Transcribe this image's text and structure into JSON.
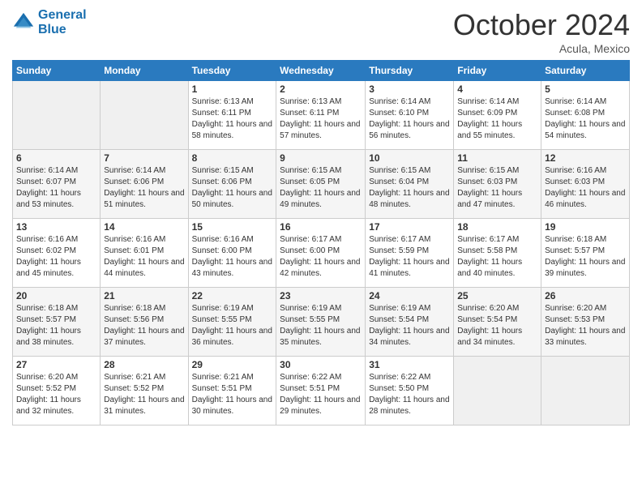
{
  "logo": {
    "line1": "General",
    "line2": "Blue"
  },
  "header": {
    "month": "October 2024",
    "location": "Acula, Mexico"
  },
  "weekdays": [
    "Sunday",
    "Monday",
    "Tuesday",
    "Wednesday",
    "Thursday",
    "Friday",
    "Saturday"
  ],
  "weeks": [
    [
      {
        "day": "",
        "sunrise": "",
        "sunset": "",
        "daylight": "",
        "empty": true
      },
      {
        "day": "",
        "sunrise": "",
        "sunset": "",
        "daylight": "",
        "empty": true
      },
      {
        "day": "1",
        "sunrise": "Sunrise: 6:13 AM",
        "sunset": "Sunset: 6:11 PM",
        "daylight": "Daylight: 11 hours and 58 minutes."
      },
      {
        "day": "2",
        "sunrise": "Sunrise: 6:13 AM",
        "sunset": "Sunset: 6:11 PM",
        "daylight": "Daylight: 11 hours and 57 minutes."
      },
      {
        "day": "3",
        "sunrise": "Sunrise: 6:14 AM",
        "sunset": "Sunset: 6:10 PM",
        "daylight": "Daylight: 11 hours and 56 minutes."
      },
      {
        "day": "4",
        "sunrise": "Sunrise: 6:14 AM",
        "sunset": "Sunset: 6:09 PM",
        "daylight": "Daylight: 11 hours and 55 minutes."
      },
      {
        "day": "5",
        "sunrise": "Sunrise: 6:14 AM",
        "sunset": "Sunset: 6:08 PM",
        "daylight": "Daylight: 11 hours and 54 minutes."
      }
    ],
    [
      {
        "day": "6",
        "sunrise": "Sunrise: 6:14 AM",
        "sunset": "Sunset: 6:07 PM",
        "daylight": "Daylight: 11 hours and 53 minutes."
      },
      {
        "day": "7",
        "sunrise": "Sunrise: 6:14 AM",
        "sunset": "Sunset: 6:06 PM",
        "daylight": "Daylight: 11 hours and 51 minutes."
      },
      {
        "day": "8",
        "sunrise": "Sunrise: 6:15 AM",
        "sunset": "Sunset: 6:06 PM",
        "daylight": "Daylight: 11 hours and 50 minutes."
      },
      {
        "day": "9",
        "sunrise": "Sunrise: 6:15 AM",
        "sunset": "Sunset: 6:05 PM",
        "daylight": "Daylight: 11 hours and 49 minutes."
      },
      {
        "day": "10",
        "sunrise": "Sunrise: 6:15 AM",
        "sunset": "Sunset: 6:04 PM",
        "daylight": "Daylight: 11 hours and 48 minutes."
      },
      {
        "day": "11",
        "sunrise": "Sunrise: 6:15 AM",
        "sunset": "Sunset: 6:03 PM",
        "daylight": "Daylight: 11 hours and 47 minutes."
      },
      {
        "day": "12",
        "sunrise": "Sunrise: 6:16 AM",
        "sunset": "Sunset: 6:03 PM",
        "daylight": "Daylight: 11 hours and 46 minutes."
      }
    ],
    [
      {
        "day": "13",
        "sunrise": "Sunrise: 6:16 AM",
        "sunset": "Sunset: 6:02 PM",
        "daylight": "Daylight: 11 hours and 45 minutes."
      },
      {
        "day": "14",
        "sunrise": "Sunrise: 6:16 AM",
        "sunset": "Sunset: 6:01 PM",
        "daylight": "Daylight: 11 hours and 44 minutes."
      },
      {
        "day": "15",
        "sunrise": "Sunrise: 6:16 AM",
        "sunset": "Sunset: 6:00 PM",
        "daylight": "Daylight: 11 hours and 43 minutes."
      },
      {
        "day": "16",
        "sunrise": "Sunrise: 6:17 AM",
        "sunset": "Sunset: 6:00 PM",
        "daylight": "Daylight: 11 hours and 42 minutes."
      },
      {
        "day": "17",
        "sunrise": "Sunrise: 6:17 AM",
        "sunset": "Sunset: 5:59 PM",
        "daylight": "Daylight: 11 hours and 41 minutes."
      },
      {
        "day": "18",
        "sunrise": "Sunrise: 6:17 AM",
        "sunset": "Sunset: 5:58 PM",
        "daylight": "Daylight: 11 hours and 40 minutes."
      },
      {
        "day": "19",
        "sunrise": "Sunrise: 6:18 AM",
        "sunset": "Sunset: 5:57 PM",
        "daylight": "Daylight: 11 hours and 39 minutes."
      }
    ],
    [
      {
        "day": "20",
        "sunrise": "Sunrise: 6:18 AM",
        "sunset": "Sunset: 5:57 PM",
        "daylight": "Daylight: 11 hours and 38 minutes."
      },
      {
        "day": "21",
        "sunrise": "Sunrise: 6:18 AM",
        "sunset": "Sunset: 5:56 PM",
        "daylight": "Daylight: 11 hours and 37 minutes."
      },
      {
        "day": "22",
        "sunrise": "Sunrise: 6:19 AM",
        "sunset": "Sunset: 5:55 PM",
        "daylight": "Daylight: 11 hours and 36 minutes."
      },
      {
        "day": "23",
        "sunrise": "Sunrise: 6:19 AM",
        "sunset": "Sunset: 5:55 PM",
        "daylight": "Daylight: 11 hours and 35 minutes."
      },
      {
        "day": "24",
        "sunrise": "Sunrise: 6:19 AM",
        "sunset": "Sunset: 5:54 PM",
        "daylight": "Daylight: 11 hours and 34 minutes."
      },
      {
        "day": "25",
        "sunrise": "Sunrise: 6:20 AM",
        "sunset": "Sunset: 5:54 PM",
        "daylight": "Daylight: 11 hours and 34 minutes."
      },
      {
        "day": "26",
        "sunrise": "Sunrise: 6:20 AM",
        "sunset": "Sunset: 5:53 PM",
        "daylight": "Daylight: 11 hours and 33 minutes."
      }
    ],
    [
      {
        "day": "27",
        "sunrise": "Sunrise: 6:20 AM",
        "sunset": "Sunset: 5:52 PM",
        "daylight": "Daylight: 11 hours and 32 minutes."
      },
      {
        "day": "28",
        "sunrise": "Sunrise: 6:21 AM",
        "sunset": "Sunset: 5:52 PM",
        "daylight": "Daylight: 11 hours and 31 minutes."
      },
      {
        "day": "29",
        "sunrise": "Sunrise: 6:21 AM",
        "sunset": "Sunset: 5:51 PM",
        "daylight": "Daylight: 11 hours and 30 minutes."
      },
      {
        "day": "30",
        "sunrise": "Sunrise: 6:22 AM",
        "sunset": "Sunset: 5:51 PM",
        "daylight": "Daylight: 11 hours and 29 minutes."
      },
      {
        "day": "31",
        "sunrise": "Sunrise: 6:22 AM",
        "sunset": "Sunset: 5:50 PM",
        "daylight": "Daylight: 11 hours and 28 minutes."
      },
      {
        "day": "",
        "sunrise": "",
        "sunset": "",
        "daylight": "",
        "empty": true
      },
      {
        "day": "",
        "sunrise": "",
        "sunset": "",
        "daylight": "",
        "empty": true
      }
    ]
  ]
}
